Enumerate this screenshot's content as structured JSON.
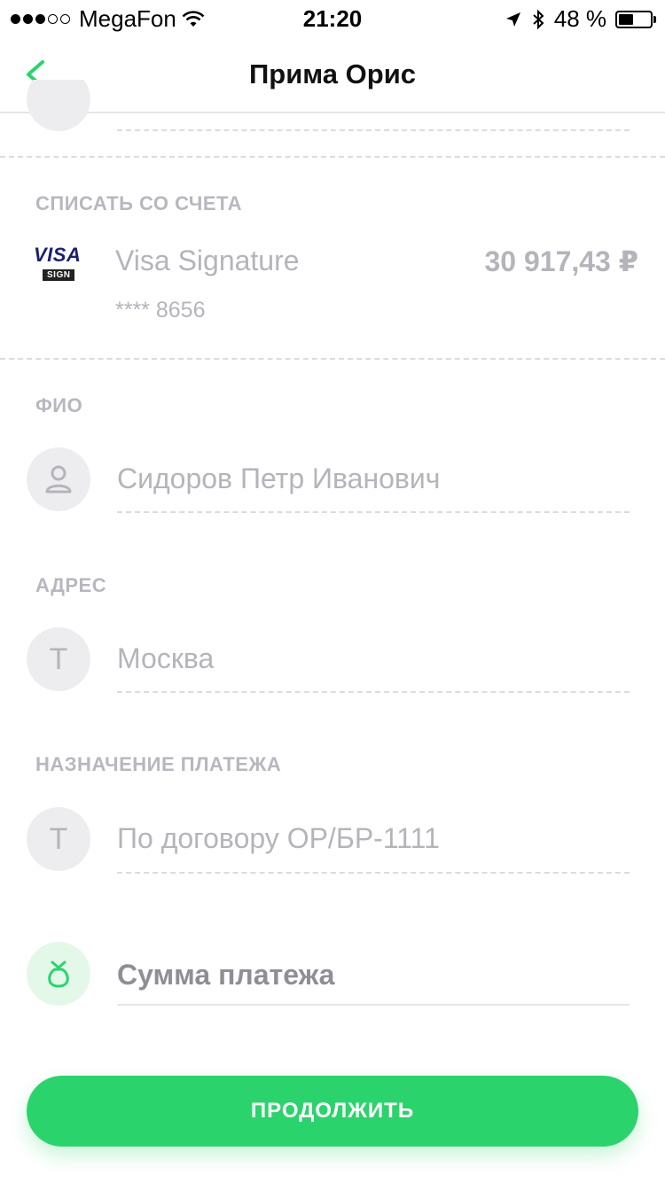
{
  "status_bar": {
    "carrier": "MegaFon",
    "time": "21:20",
    "battery_text": "48 %",
    "battery_level": 0.48
  },
  "nav": {
    "title": "Прима Орис",
    "accent_color": "#2bd36d"
  },
  "account": {
    "label": "СПИСАТЬ СО СЧЕТА",
    "card_brand": "VISA",
    "card_sub": "SIGN",
    "card_name": "Visa Signature",
    "amount": "30 917,43 ₽",
    "masked_number": "**** 8656"
  },
  "fields": {
    "fio": {
      "label": "ФИО",
      "value": "Сидоров Петр Иванович",
      "icon": "person-icon"
    },
    "address": {
      "label": "АДРЕС",
      "value": "Москва",
      "icon": "text-t-icon",
      "icon_glyph": "T"
    },
    "purpose": {
      "label": "НАЗНАЧЕНИЕ ПЛАТЕЖА",
      "value": "По договору ОР/БР-1111",
      "icon": "text-t-icon",
      "icon_glyph": "T"
    },
    "amount": {
      "placeholder": "Сумма платежа",
      "icon": "money-bag-icon"
    }
  },
  "cta": {
    "label": "ПРОДОЛЖИТЬ",
    "color": "#2bd36d"
  }
}
